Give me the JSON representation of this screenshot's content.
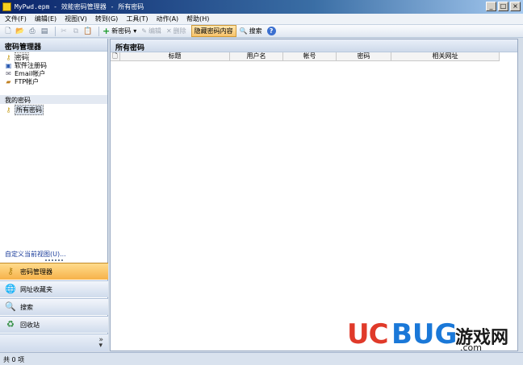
{
  "window": {
    "title": "MyPwd.epm - 效能密码管理器 - 所有密码",
    "buttons": [
      "_",
      "□",
      "×"
    ]
  },
  "menu": [
    {
      "label": "文件(F)"
    },
    {
      "label": "编辑(E)"
    },
    {
      "label": "视图(V)"
    },
    {
      "label": "转到(G)"
    },
    {
      "label": "工具(T)"
    },
    {
      "label": "动作(A)"
    },
    {
      "label": "帮助(H)"
    }
  ],
  "toolbar": {
    "new_password": "新密码",
    "edit": "编辑",
    "delete": "删除",
    "hide_content": "隐藏密码内容",
    "search": "搜索",
    "help": "?"
  },
  "sidebar": {
    "header": "密码管理器",
    "tree": [
      {
        "label": "密码",
        "icon": "key-icon"
      },
      {
        "label": "软件注册码",
        "icon": "software-icon"
      },
      {
        "label": "Email帐户",
        "icon": "email-icon"
      },
      {
        "label": "FTP帐户",
        "icon": "ftp-icon"
      }
    ],
    "my_section": "我的密码",
    "my_items": [
      {
        "label": "所有密码",
        "icon": "key-icon",
        "selected": true
      }
    ],
    "customize": "自定义当前视图(U)...",
    "nav": [
      {
        "label": "密码管理器",
        "icon": "key-icon",
        "active": true
      },
      {
        "label": "网址收藏夹",
        "icon": "globe-icon"
      },
      {
        "label": "搜索",
        "icon": "search-icon"
      },
      {
        "label": "回收站",
        "icon": "recycle-icon"
      }
    ]
  },
  "content": {
    "header": "所有密码",
    "columns": [
      "",
      "标题",
      "用户名",
      "帐号",
      "密码",
      "相关网址"
    ]
  },
  "status": {
    "text": "共 0 项"
  },
  "watermark": {
    "uc": "UC",
    "bug": "BUG",
    "cn": "游戏网",
    "com": ".com"
  }
}
